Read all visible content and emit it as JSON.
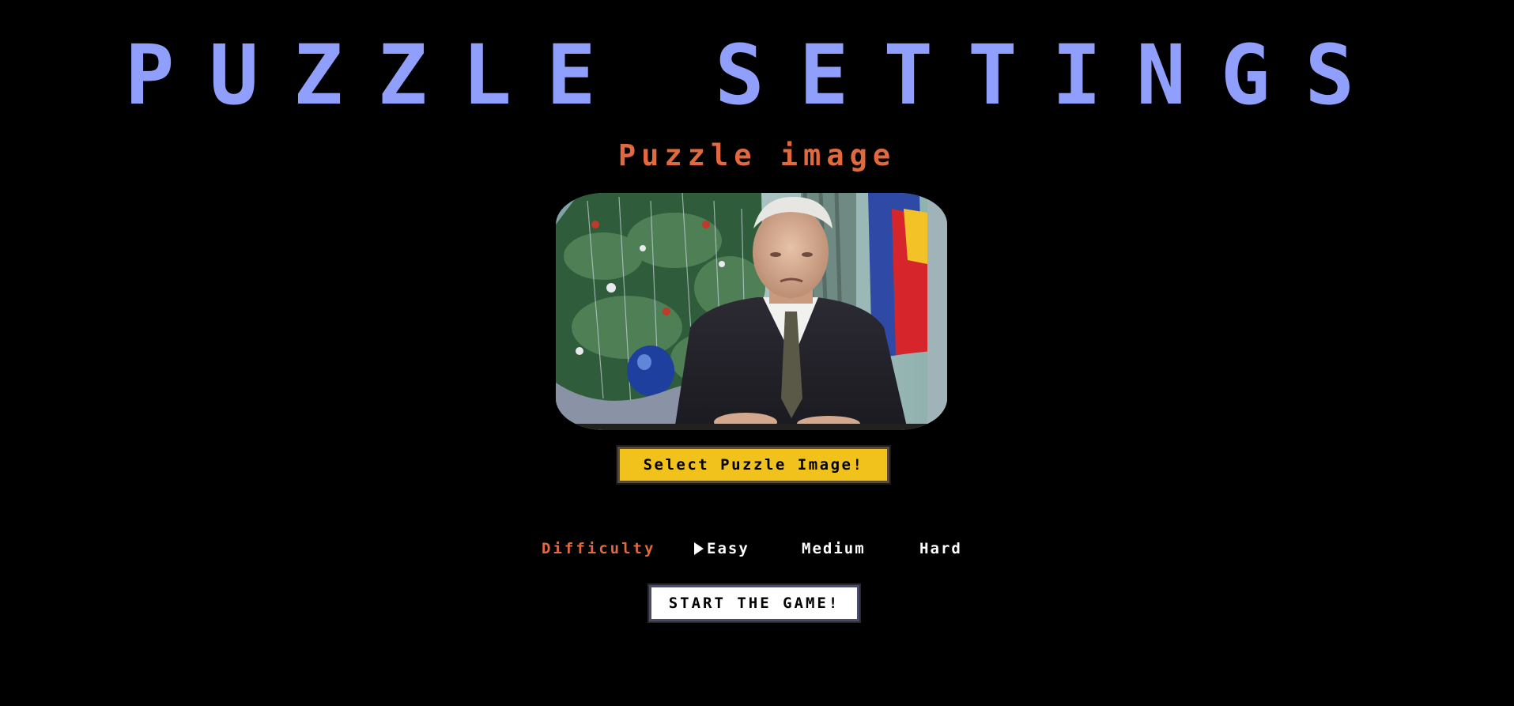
{
  "page": {
    "title": "PUZZLE SETTINGS"
  },
  "image_section": {
    "heading": "Puzzle image",
    "select_button_label": "Select Puzzle Image!"
  },
  "difficulty": {
    "label": "Difficulty",
    "options": [
      "Easy",
      "Medium",
      "Hard"
    ],
    "selected": "Easy",
    "pointer_icon": "triangle-pointer-icon"
  },
  "start_button_label": "START THE GAME!",
  "colors": {
    "background": "#000000",
    "title": "#8f9ffb",
    "accent": "#e2683e",
    "select_button": "#f2c21c",
    "start_button": "#ffffff"
  }
}
